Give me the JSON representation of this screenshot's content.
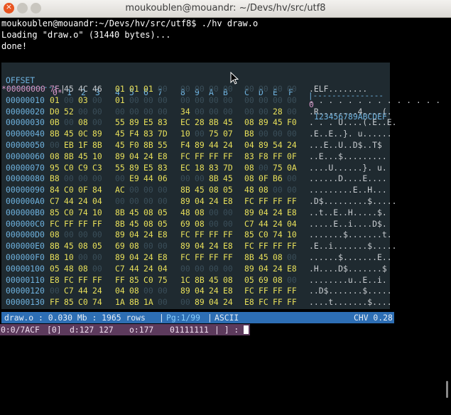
{
  "window": {
    "title": "moukoublen@mouandr: ~/Devs/hv/src/utf8"
  },
  "terminal": {
    "prompt": "moukoublen@mouandr:~/Devs/hv/src/utf8$ ./hv draw.o",
    "loading": "Loading \"draw.o\" (31440 bytes)...",
    "done": "done!"
  },
  "hex": {
    "header_offset": "OFFSET",
    "header_cols": [
      "0*",
      "1",
      "2",
      "3",
      "4",
      "5",
      "6",
      "7",
      "8",
      "9",
      "A",
      "B",
      "C",
      "D",
      "E",
      "F"
    ],
    "header_ascii_first": "0",
    "header_ascii_rest": "123456789ABCDEF",
    "dash_left": "-----------",
    "dash_right": "|---------------",
    "rows": [
      {
        "offset": "*00000000",
        "bytes": [
          "7F",
          "45",
          "4C",
          "46",
          "01",
          "01",
          "01",
          "00",
          "00",
          "00",
          "00",
          "00",
          "00",
          "00",
          "00",
          "00"
        ],
        "ascii": ".ELF........"
      },
      {
        "offset": "00000010",
        "bytes": [
          "01",
          "00",
          "03",
          "00",
          "01",
          "00",
          "00",
          "00",
          "00",
          "00",
          "00",
          "00",
          "00",
          "00",
          "00",
          "00"
        ],
        "ascii": ". . . . . . . . . . . . . ."
      },
      {
        "offset": "00000020",
        "bytes": [
          "D0",
          "52",
          "00",
          "00",
          "00",
          "00",
          "00",
          "00",
          "34",
          "00",
          "00",
          "00",
          "00",
          "00",
          "28",
          "00"
        ],
        "ascii": ".R........4....(."
      },
      {
        "offset": "00000030",
        "bytes": [
          "0B",
          "00",
          "08",
          "00",
          "55",
          "89",
          "E5",
          "83",
          "EC",
          "28",
          "8B",
          "45",
          "08",
          "89",
          "45",
          "F0"
        ],
        "ascii": ". . . U....(.E..E."
      },
      {
        "offset": "00000040",
        "bytes": [
          "8B",
          "45",
          "0C",
          "89",
          "45",
          "F4",
          "83",
          "7D",
          "10",
          "00",
          "75",
          "07",
          "B8",
          "00",
          "00",
          "00"
        ],
        "ascii": ".E..E..}. u......"
      },
      {
        "offset": "00000050",
        "bytes": [
          "00",
          "EB",
          "1F",
          "8B",
          "45",
          "F0",
          "8B",
          "55",
          "F4",
          "89",
          "44",
          "24",
          "04",
          "89",
          "54",
          "24"
        ],
        "ascii": "...E..U..D$..T$"
      },
      {
        "offset": "00000060",
        "bytes": [
          "08",
          "8B",
          "45",
          "10",
          "89",
          "04",
          "24",
          "E8",
          "FC",
          "FF",
          "FF",
          "FF",
          "83",
          "F8",
          "FF",
          "0F"
        ],
        "ascii": "..E...$........."
      },
      {
        "offset": "00000070",
        "bytes": [
          "95",
          "C0",
          "C9",
          "C3",
          "55",
          "89",
          "E5",
          "83",
          "EC",
          "18",
          "83",
          "7D",
          "08",
          "00",
          "75",
          "0A"
        ],
        "ascii": "....U......}. u."
      },
      {
        "offset": "00000080",
        "bytes": [
          "B8",
          "00",
          "00",
          "00",
          "00",
          "E9",
          "44",
          "06",
          "00",
          "00",
          "8B",
          "45",
          "08",
          "0F",
          "B6",
          "00"
        ],
        "ascii": "......D....E...."
      },
      {
        "offset": "00000090",
        "bytes": [
          "84",
          "C0",
          "0F",
          "84",
          "AC",
          "00",
          "00",
          "00",
          "8B",
          "45",
          "08",
          "05",
          "48",
          "08",
          "00",
          "00"
        ],
        "ascii": ".........E..H..."
      },
      {
        "offset": "000000A0",
        "bytes": [
          "C7",
          "44",
          "24",
          "04",
          "00",
          "00",
          "00",
          "00",
          "89",
          "04",
          "24",
          "E8",
          "FC",
          "FF",
          "FF",
          "FF"
        ],
        "ascii": ".D$.........$....."
      },
      {
        "offset": "000000B0",
        "bytes": [
          "85",
          "C0",
          "74",
          "10",
          "8B",
          "45",
          "08",
          "05",
          "48",
          "08",
          "00",
          "00",
          "89",
          "04",
          "24",
          "E8"
        ],
        "ascii": "..t..E..H.....$."
      },
      {
        "offset": "000000C0",
        "bytes": [
          "FC",
          "FF",
          "FF",
          "FF",
          "8B",
          "45",
          "08",
          "05",
          "69",
          "08",
          "00",
          "00",
          "C7",
          "44",
          "24",
          "04"
        ],
        "ascii": ".....E..i....D$."
      },
      {
        "offset": "000000D0",
        "bytes": [
          "08",
          "00",
          "00",
          "00",
          "89",
          "04",
          "24",
          "E8",
          "FC",
          "FF",
          "FF",
          "FF",
          "85",
          "C0",
          "74",
          "10"
        ],
        "ascii": ".......$.......t."
      },
      {
        "offset": "000000E0",
        "bytes": [
          "8B",
          "45",
          "08",
          "05",
          "69",
          "08",
          "00",
          "00",
          "89",
          "04",
          "24",
          "E8",
          "FC",
          "FF",
          "FF",
          "FF"
        ],
        "ascii": ".E..i.......$....."
      },
      {
        "offset": "000000F0",
        "bytes": [
          "B8",
          "10",
          "00",
          "00",
          "89",
          "04",
          "24",
          "E8",
          "FC",
          "FF",
          "FF",
          "FF",
          "8B",
          "45",
          "08",
          "00"
        ],
        "ascii": "......$.......E.."
      },
      {
        "offset": "00000100",
        "bytes": [
          "05",
          "48",
          "08",
          "00",
          "C7",
          "44",
          "24",
          "04",
          "00",
          "00",
          "00",
          "00",
          "89",
          "04",
          "24",
          "E8"
        ],
        "ascii": ".H....D$.......$"
      },
      {
        "offset": "00000110",
        "bytes": [
          "E8",
          "FC",
          "FF",
          "FF",
          "FF",
          "85",
          "C0",
          "75",
          "1C",
          "8B",
          "45",
          "08",
          "05",
          "69",
          "08",
          "00"
        ],
        "ascii": "........u..E..i."
      },
      {
        "offset": "00000120",
        "bytes": [
          "00",
          "C7",
          "44",
          "24",
          "04",
          "08",
          "00",
          "00",
          "89",
          "04",
          "24",
          "E8",
          "FC",
          "FF",
          "FF",
          "FF"
        ],
        "ascii": "..D$.......$....."
      },
      {
        "offset": "00000130",
        "bytes": [
          "FF",
          "85",
          "C0",
          "74",
          "1A",
          "8B",
          "1A",
          "00",
          "00",
          "89",
          "04",
          "24",
          "E8",
          "FC",
          "FF",
          "FF"
        ],
        "ascii": "....t.......$...."
      }
    ]
  },
  "status": {
    "file": "draw.o : 0.030 Mb : 1965 rows",
    "sep": "|",
    "page": "Pg:1/99",
    "sep2": "|",
    "mode": "ASCII",
    "chv": "CHV 0.28"
  },
  "cmd": {
    "pos": "0:0/7ACF",
    "idx": "[0]",
    "dec": "d:127 127",
    "oct": "o:177",
    "bin": "01111111",
    "tail": "| ] :"
  }
}
